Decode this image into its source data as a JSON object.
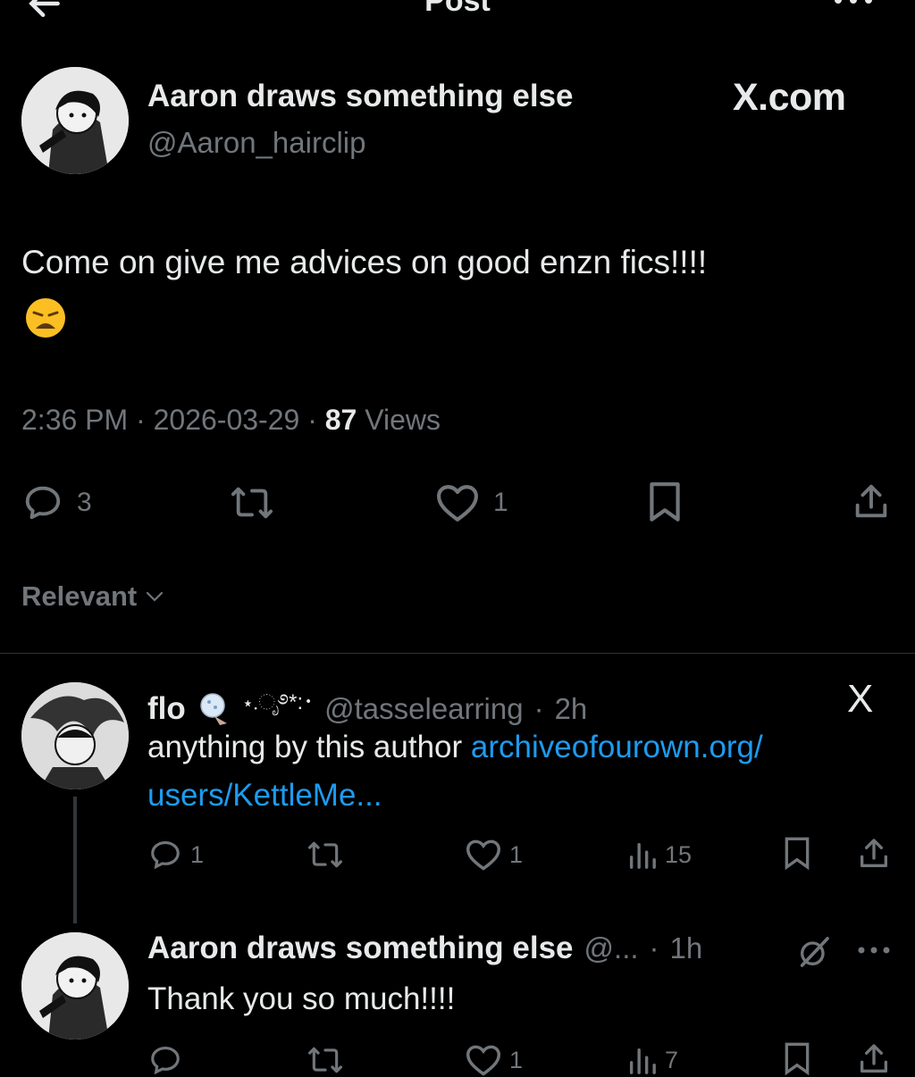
{
  "header": {
    "title": "Post",
    "back_icon": "arrow-left-icon",
    "more_icon": "more-horizontal-icon"
  },
  "post": {
    "author_name": "Aaron draws something else",
    "author_handle": "@Aaron_hairclip",
    "watermark": "X.com",
    "text": "Come on give me advices on good enzn fics!!!!",
    "emoji": "weary-face",
    "time": "2:36 PM",
    "date": "2026-03-29",
    "views_count": "87",
    "views_label": "Views",
    "sep": "·",
    "replies": "3",
    "likes": "1"
  },
  "sort": {
    "label": "Relevant"
  },
  "replies": [
    {
      "author_name": "flo",
      "name_decoration": "⋆.ೃ࿔*:･",
      "author_handle": "@tasselearring",
      "time": "2h",
      "text": "anything by this author",
      "link_line1": "archiveofourown.org/",
      "link_line2": "users/KettleMe...",
      "replies": "1",
      "likes": "1",
      "views": "15",
      "corner": "X"
    },
    {
      "author_name": "Aaron draws something else",
      "author_handle": "@...",
      "time": "1h",
      "text": "Thank you so much!!!!",
      "replies": "",
      "likes": "1",
      "views": "7"
    }
  ],
  "colors": {
    "background": "#000000",
    "text": "#e7e9ea",
    "muted": "#71767b",
    "link": "#1d9bf0",
    "divider": "#2f3336"
  }
}
